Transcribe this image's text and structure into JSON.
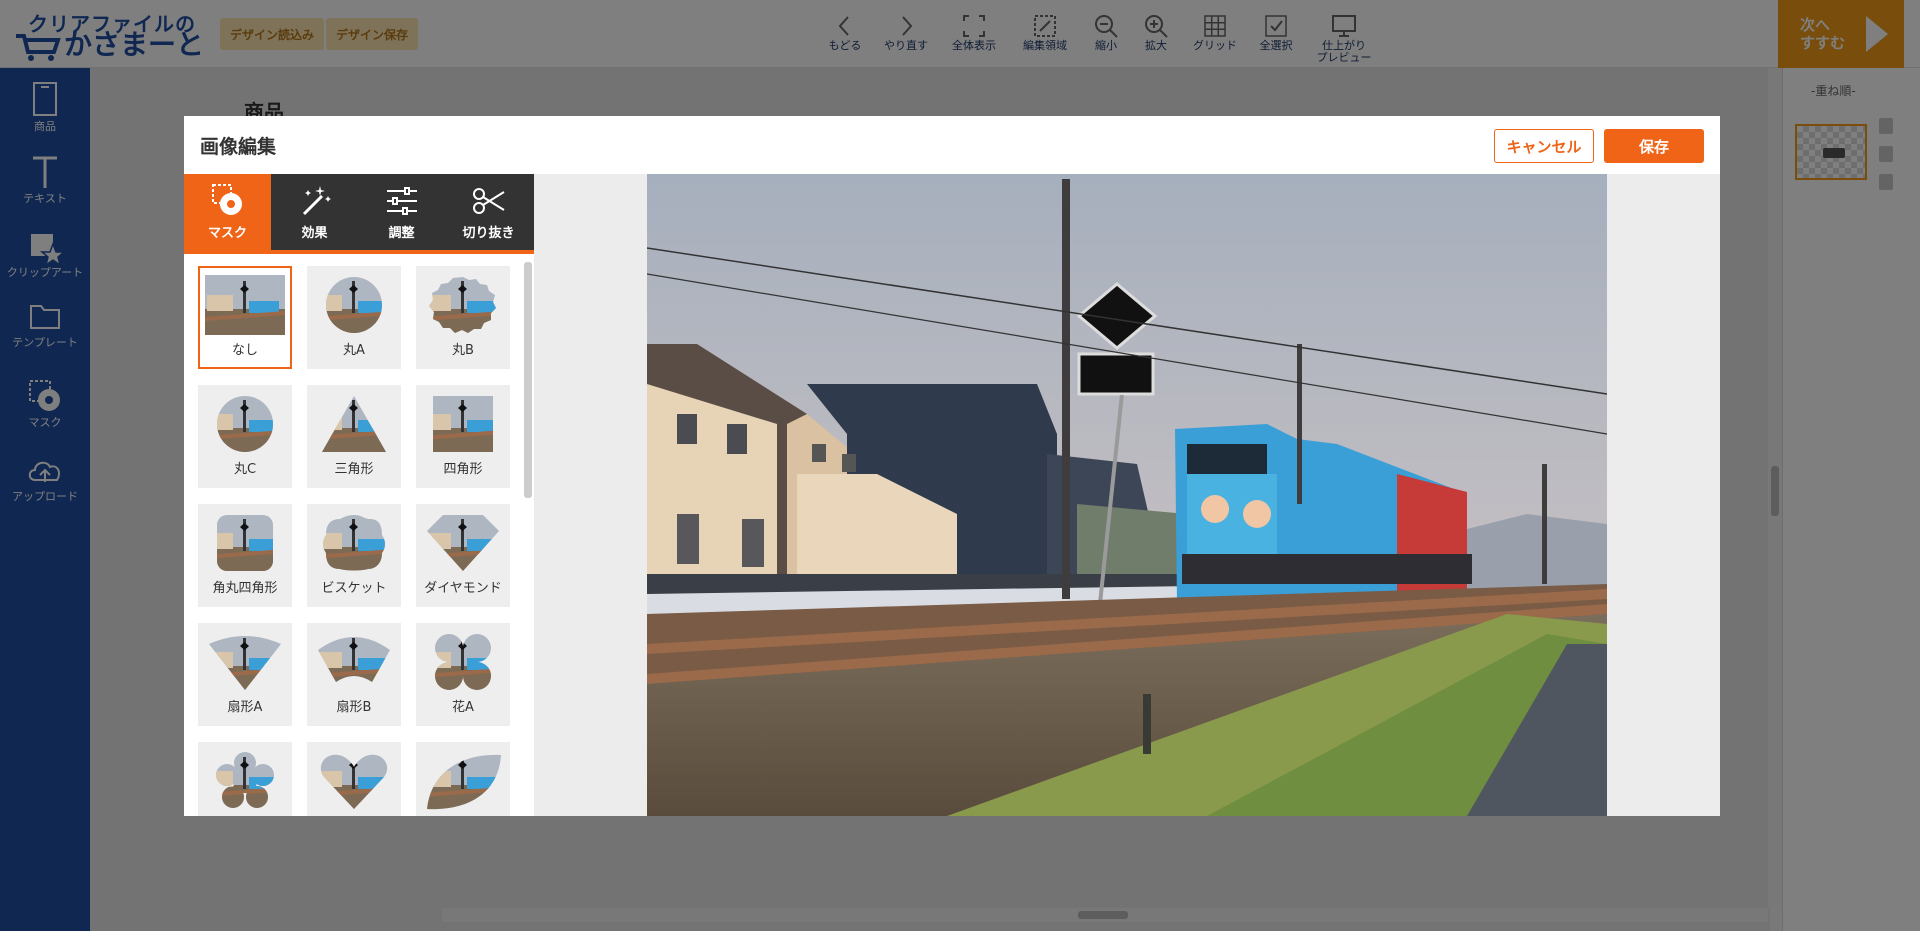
{
  "header": {
    "logo_line1": "クリアファイルの",
    "logo_line2": "かさまーと",
    "load_design": "デザイン読込み",
    "save_design": "デザイン保存",
    "tools": [
      {
        "label": "もどる",
        "icon": "undo-icon"
      },
      {
        "label": "やり直す",
        "icon": "redo-icon"
      },
      {
        "label": "全体表示",
        "icon": "fit-view-icon"
      },
      {
        "label": "編集領域",
        "icon": "edit-area-icon"
      },
      {
        "label": "縮小",
        "icon": "zoom-out-icon"
      },
      {
        "label": "拡大",
        "icon": "zoom-in-icon"
      },
      {
        "label": "グリッド",
        "icon": "grid-icon"
      },
      {
        "label": "全選択",
        "icon": "select-all-icon"
      },
      {
        "label": "仕上がり",
        "label2": "プレビュー",
        "icon": "monitor-icon"
      }
    ],
    "next_line1": "次へ",
    "next_line2": "すすむ"
  },
  "sidebar": {
    "items": [
      {
        "label": "商品",
        "icon": "product-icon"
      },
      {
        "label": "テキスト",
        "icon": "text-icon"
      },
      {
        "label": "クリップアート",
        "icon": "clipart-icon"
      },
      {
        "label": "テンプレート",
        "icon": "template-icon"
      },
      {
        "label": "マスク",
        "icon": "mask-icon"
      },
      {
        "label": "アップロード",
        "icon": "upload-icon"
      }
    ]
  },
  "canvas": {
    "product_label": "商品"
  },
  "layers": {
    "title": "-重ね順-"
  },
  "modal": {
    "title": "画像編集",
    "cancel": "キャンセル",
    "save": "保存",
    "tabs": [
      {
        "label": "マスク",
        "icon": "mask-icon",
        "active": true
      },
      {
        "label": "効果",
        "icon": "magic-wand-icon",
        "active": false
      },
      {
        "label": "調整",
        "icon": "sliders-icon",
        "active": false
      },
      {
        "label": "切り抜き",
        "icon": "scissors-icon",
        "active": false
      }
    ],
    "masks": [
      {
        "label": "なし",
        "shape": "none",
        "selected": true
      },
      {
        "label": "丸A",
        "shape": "circle"
      },
      {
        "label": "丸B",
        "shape": "rough-circle"
      },
      {
        "label": "丸C",
        "shape": "circle-small"
      },
      {
        "label": "三角形",
        "shape": "triangle"
      },
      {
        "label": "四角形",
        "shape": "square"
      },
      {
        "label": "角丸四角形",
        "shape": "rounded-square"
      },
      {
        "label": "ビスケット",
        "shape": "biscuit"
      },
      {
        "label": "ダイヤモンド",
        "shape": "diamond"
      },
      {
        "label": "扇形A",
        "shape": "fan-a"
      },
      {
        "label": "扇形B",
        "shape": "fan-b"
      },
      {
        "label": "花A",
        "shape": "flower-a"
      },
      {
        "label": "",
        "shape": "flower-b"
      },
      {
        "label": "",
        "shape": "heart"
      },
      {
        "label": "",
        "shape": "leaf"
      }
    ]
  },
  "colors": {
    "brand_blue": "#1f4fa3",
    "accent_orange": "#f06418",
    "next_orange": "#f29b17",
    "tab_dark": "#333333"
  }
}
